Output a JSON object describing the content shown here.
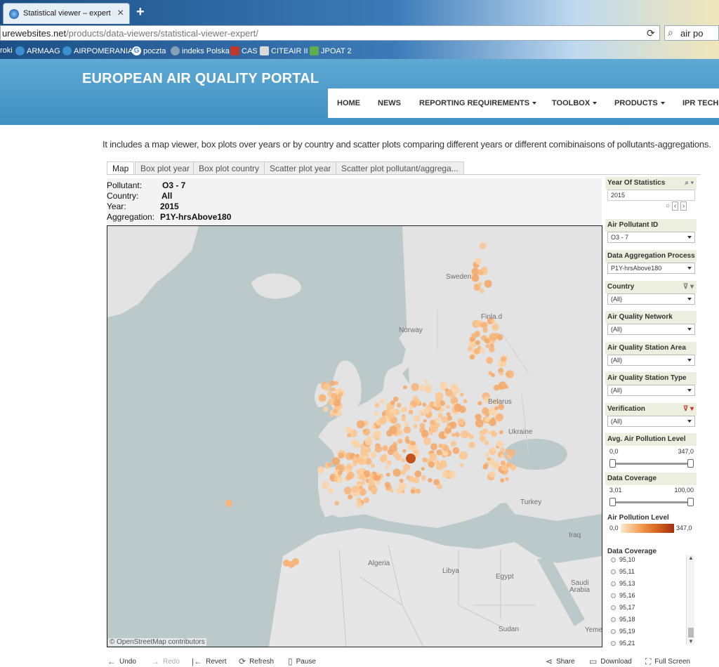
{
  "browser": {
    "tab_title": "Statistical viewer – expert – E",
    "url_host": "urewebsites.net",
    "url_path": "/products/data-viewers/statistical-viewer-expert/",
    "search_text": "air po",
    "bookmarks": [
      {
        "label": "roki",
        "icon": "none",
        "color": ""
      },
      {
        "label": "ARMAAG",
        "icon": "globe-icon",
        "color": "#3b8fd1"
      },
      {
        "label": "AIRPOMERANIA",
        "icon": "globe-icon",
        "color": "#3b8fd1"
      },
      {
        "label": "poczta",
        "icon": "google-icon",
        "color": "#ffffff"
      },
      {
        "label": "indeks Polska",
        "icon": "world-icon",
        "color": "#8aa0b8"
      },
      {
        "label": "CAS",
        "icon": "cas-icon",
        "color": "#c0392b"
      },
      {
        "label": "CITEAIR II",
        "icon": "bus-icon",
        "color": "#d9d9d9"
      },
      {
        "label": "JPOAT 2",
        "icon": "sheet-icon",
        "color": "#5fae4e"
      }
    ]
  },
  "site": {
    "portal_title": "EUROPEAN AIR QUALITY PORTAL",
    "nav": [
      "HOME",
      "NEWS",
      "REPORTING REQUIREMENTS",
      "TOOLBOX",
      "PRODUCTS",
      "IPR TECHI"
    ],
    "intro": "It includes a map viewer, box plots over years or by country and scatter plots comparing different years or different comibinaisons of pollutants-aggregations."
  },
  "viewer": {
    "tabs": [
      "Map",
      "Box plot year",
      "Box plot country",
      "Scatter plot year",
      "Scatter plot pollutant/aggrega..."
    ],
    "active_tab": "Map",
    "info": {
      "pollutant_label": "Pollutant:",
      "pollutant_value": "O3 - 7",
      "country_label": "Country:",
      "country_value": "All",
      "year_label": "Year:",
      "year_value": "2015",
      "aggregation_label": "Aggregation:",
      "aggregation_value": "P1Y-hrsAbove180"
    },
    "map_labels": {
      "sweden": "Sweden",
      "norway": "Norway",
      "finland": "Finla.d",
      "belarus": "Belarus",
      "ukraine": "Ukraine",
      "turkey": "Turkey",
      "iraq": "Iraq",
      "algeria": "Algeria",
      "libya": "Libya",
      "egypt": "Egypt",
      "saudi1": "Saudi",
      "saudi2": "Arabia",
      "sudan": "Sudan",
      "yemen": "Yeme"
    },
    "attribution": "© OpenStreetMap contributors"
  },
  "filters": {
    "year": {
      "title": "Year Of Statistics",
      "value": "2015"
    },
    "pollutant": {
      "title": "Air Pollutant ID",
      "value": "O3 - 7"
    },
    "aggregation": {
      "title": "Data Aggregation Process",
      "value": "P1Y-hrsAbove180"
    },
    "country": {
      "title": "Country",
      "value": "(All)"
    },
    "network": {
      "title": "Air Quality Network",
      "value": "(All)"
    },
    "area": {
      "title": "Air Quality Station Area",
      "value": "(All)"
    },
    "type": {
      "title": "Air Quality Station Type",
      "value": "(All)"
    },
    "verification": {
      "title": "Verification",
      "value": "(All)"
    },
    "avg_level": {
      "title": "Avg. Air Pollution Level",
      "min": "0,0",
      "max": "347,0"
    },
    "coverage_range": {
      "title": "Data Coverage",
      "min": "3,01",
      "max": "100,00"
    },
    "legend": {
      "title": "Air Pollution Level",
      "min": "0,0",
      "max": "347,0"
    },
    "coverage_list": {
      "title": "Data Coverage",
      "items": [
        "95,10",
        "95,11",
        "95,13",
        "95,16",
        "95,17",
        "95,18",
        "95,19",
        "95,21"
      ]
    }
  },
  "toolbar": {
    "undo": "Undo",
    "redo": "Redo",
    "revert": "Revert",
    "refresh": "Refresh",
    "pause": "Pause",
    "share": "Share",
    "download": "Download",
    "fullscreen": "Full Screen"
  }
}
